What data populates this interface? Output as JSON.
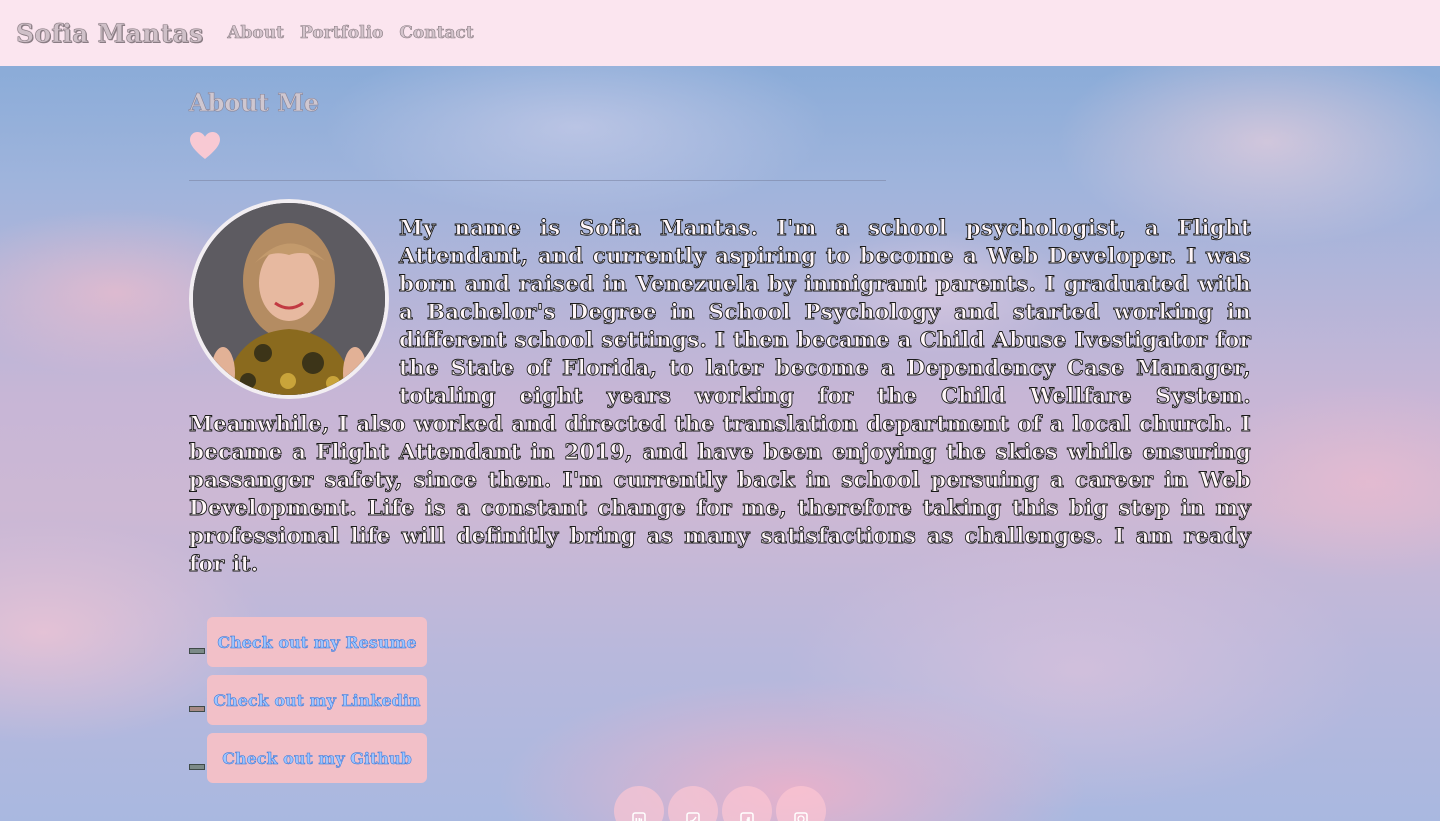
{
  "nav": {
    "brand": "Sofia Mantas",
    "links": [
      "About",
      "Portfolio",
      "Contact"
    ]
  },
  "about": {
    "title": "About Me",
    "bio": "My name is Sofia Mantas. I'm a school psychologist, a Flight Attendant, and currently aspiring to become a Web Developer. I was born and raised in Venezuela by inmigrant parents. I graduated with a Bachelor's Degree in School Psychology and started working in different school settings. I then became a Child Abuse Ivestigator for the State of Florida, to later become a Dependency Case Manager, totaling eight years working for the Child Wellfare System. Meanwhile, I also worked and directed the translation department of a local church. I became a Flight Attendant in 2019, and have been enjoying the skies while ensuring passanger safety, since then. I'm currently back in school persuing a career in Web Development. Life is a constant change for me, therefore taking this big step in my professional life will definitly bring as many satisfactions as challenges. I am ready for it."
  },
  "buttons": {
    "resume": "Check out my Resume",
    "linkedin": "Check out my Linkedin",
    "github": "Check out my Github"
  },
  "social": [
    "linkedin-icon",
    "twitter-icon",
    "facebook-icon",
    "github-icon"
  ],
  "colors": {
    "navbar_bg": "#fbe5ef",
    "button_bg": "#f2c0c8",
    "button_text": "#2f6fd6",
    "heart": "#f8c9d3"
  }
}
